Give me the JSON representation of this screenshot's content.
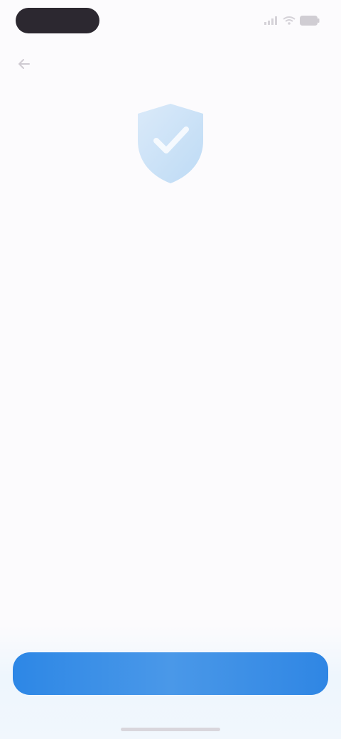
{
  "status_bar": {
    "time": "",
    "icons": [
      "signal-icon",
      "wifi-icon",
      "battery-icon"
    ]
  },
  "navigation": {
    "back_icon": "back-arrow-icon"
  },
  "hero": {
    "icon": "shield-check-icon",
    "color": "#8fc2ef"
  },
  "content": {
    "title": "",
    "subtitle": "",
    "body": ""
  },
  "primary_button": {
    "label": "",
    "color": "#3b8fe5"
  }
}
